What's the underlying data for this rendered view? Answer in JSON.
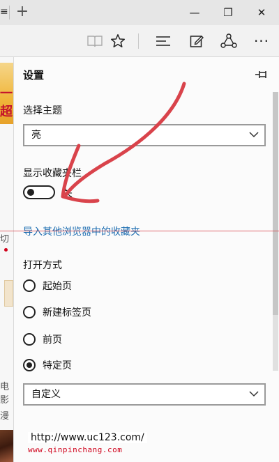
{
  "browser": {
    "tab_close_glyph": "≡",
    "new_tab_glyph": "+",
    "window_minimize": "—",
    "window_restore": "❐",
    "window_close": "✕"
  },
  "toolbar": {
    "more_glyph": "···"
  },
  "webpage": {
    "banner_text": "一超",
    "frag_1": "切",
    "frag_2": "电影",
    "frag_3": "漫"
  },
  "settings": {
    "title": "设置",
    "theme": {
      "label": "选择主题",
      "value": "亮"
    },
    "favorites_bar": {
      "label": "显示收藏夹栏",
      "state": "关",
      "on": false
    },
    "import_link": "导入其他浏览器中的收藏夹",
    "open_with": {
      "label": "打开方式",
      "options": [
        {
          "label": "起始页",
          "checked": false
        },
        {
          "label": "新建标签页",
          "checked": false
        },
        {
          "label": "前页",
          "checked": false
        },
        {
          "label": "特定页",
          "checked": true
        }
      ]
    },
    "specific_page": {
      "value": "自定义",
      "url": "http://www.uc123.com/"
    }
  },
  "watermark": "www.qinpinchang.com",
  "colors": {
    "link": "#1f6fb2",
    "annotation": "#d9434b"
  }
}
